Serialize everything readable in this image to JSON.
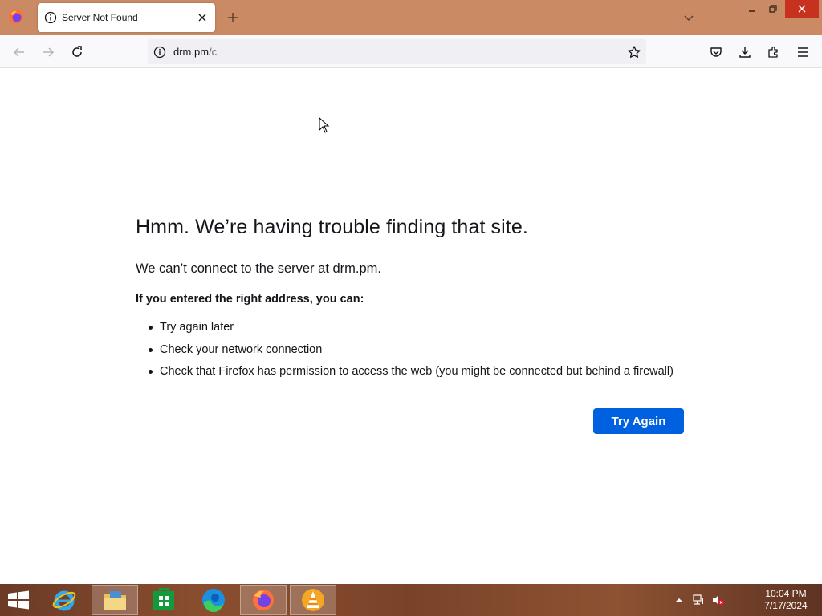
{
  "browser": {
    "tab": {
      "title": "Server Not Found",
      "icon": "info-icon"
    },
    "url": {
      "host": "drm.pm",
      "path": "/c"
    }
  },
  "error": {
    "title": "Hmm. We’re having trouble finding that site.",
    "description": "We can’t connect to the server at drm.pm.",
    "subtitle": "If you entered the right address, you can:",
    "suggestions": [
      "Try again later",
      "Check your network connection",
      "Check that Firefox has permission to access the web (you might be connected but behind a firewall)"
    ],
    "button_label": "Try Again"
  },
  "taskbar": {
    "apps": [
      "internet-explorer",
      "file-explorer",
      "store",
      "edge",
      "firefox",
      "vlc"
    ],
    "clock": {
      "time": "10:04 PM",
      "date": "7/17/2024"
    }
  },
  "colors": {
    "tabstrip": "#c98a64",
    "primary_button": "#0061e0",
    "close_button": "#c7311f"
  }
}
